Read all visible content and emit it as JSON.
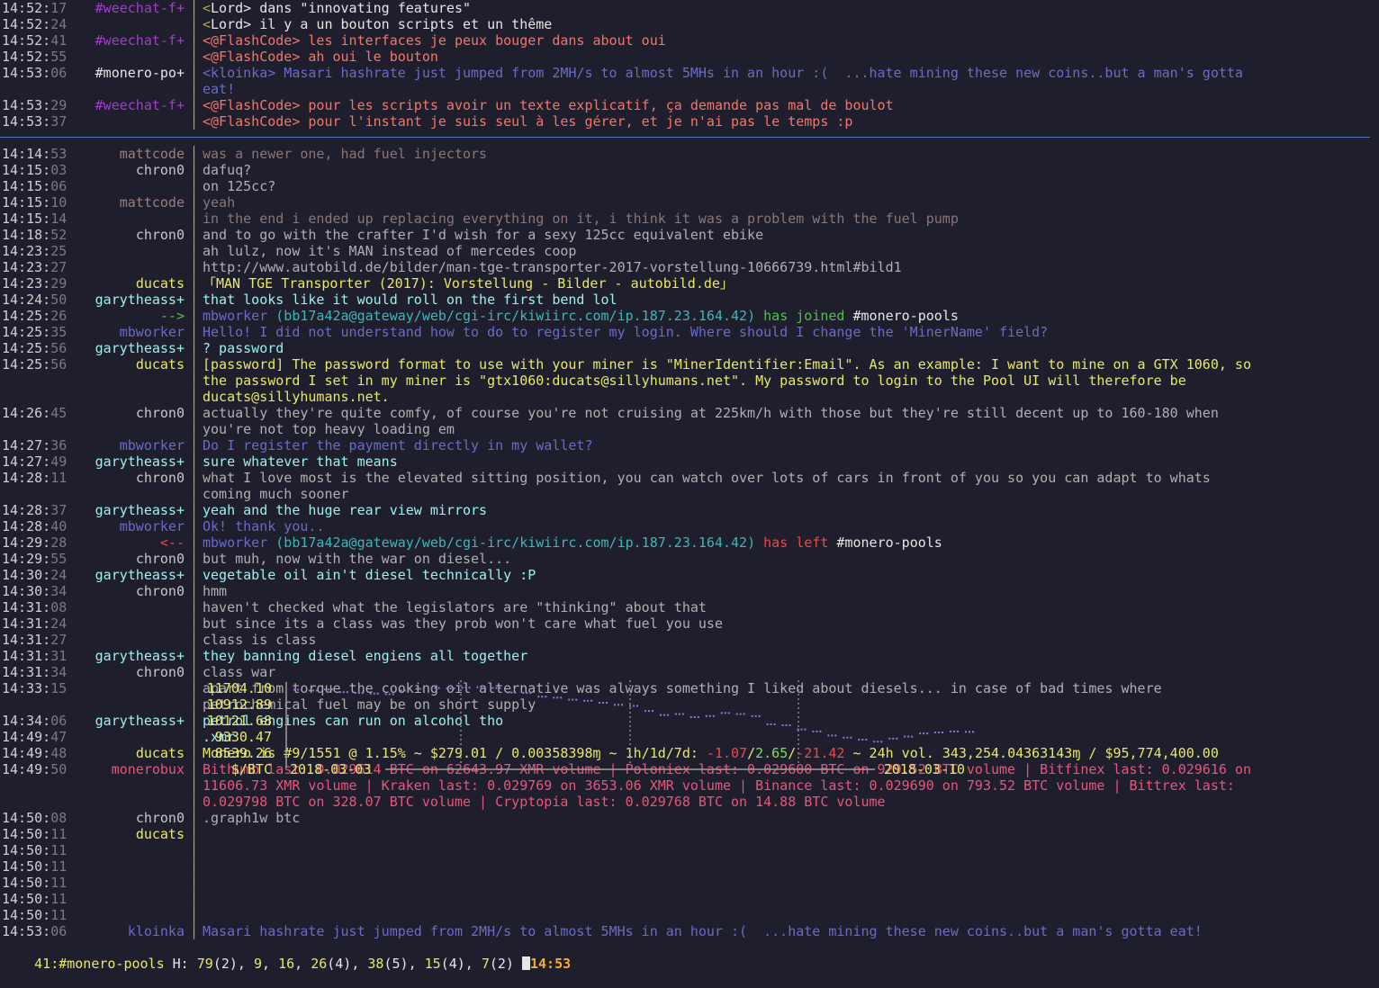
{
  "top_pane": [
    {
      "time": "14:52",
      "sec": "17",
      "nick": "#weechat-f+",
      "nick_color": "#a23fc9",
      "msg": [
        {
          "t": "<",
          "c": "#b7a63f"
        },
        {
          "t": "Lord",
          "c": "#e6e6e6"
        },
        {
          "t": "> dans \"innovating features\"",
          "c": "#e6e6e6"
        }
      ]
    },
    {
      "time": "14:52",
      "sec": "24",
      "nick": "",
      "nick_color": "#a23fc9",
      "msg": [
        {
          "t": "<",
          "c": "#b7a63f"
        },
        {
          "t": "Lord",
          "c": "#e6e6e6"
        },
        {
          "t": "> il y a un bouton scripts et un thême",
          "c": "#e6e6e6"
        }
      ]
    },
    {
      "time": "14:52",
      "sec": "41",
      "nick": "#weechat-f+",
      "nick_color": "#a23fc9",
      "msg": [
        {
          "t": "<@FlashCode> les interfaces je peux bouger dans about oui",
          "c": "#f0776c"
        }
      ]
    },
    {
      "time": "14:52",
      "sec": "55",
      "nick": "",
      "nick_color": "#a23fc9",
      "msg": [
        {
          "t": "<@FlashCode> ah oui le bouton",
          "c": "#f0776c"
        }
      ]
    },
    {
      "time": "14:53",
      "sec": "06",
      "nick": "#monero-po+",
      "nick_color": "#e6e6e6",
      "msg": [
        {
          "t": "<kloinka> Masari hashrate just jumped from 2MH/s to almost 5MHs in an hour :(  ...hate mining these new coins..but a man's gotta",
          "c": "#6b6bc7"
        }
      ]
    },
    {
      "time": "",
      "sec": "",
      "nick": "",
      "nick_color": "#e6e6e6",
      "msg": [
        {
          "t": "eat!",
          "c": "#6b6bc7"
        }
      ]
    },
    {
      "time": "14:53",
      "sec": "29",
      "nick": "#weechat-f+",
      "nick_color": "#a23fc9",
      "msg": [
        {
          "t": "<@FlashCode> pour les scripts avoir un texte explicatif, ça demande pas mal de boulot",
          "c": "#f0776c"
        }
      ]
    },
    {
      "time": "14:53",
      "sec": "37",
      "nick": "",
      "nick_color": "#a23fc9",
      "msg": [
        {
          "t": "<@FlashCode> pour l'instant je suis seul à les gérer, et je n'ai pas le temps :p",
          "c": "#f0776c"
        }
      ]
    }
  ],
  "bottom_pane": [
    {
      "time": "14:14",
      "sec": "53",
      "nick": "mattcode",
      "nick_color": "#9b7f7f",
      "msg": [
        {
          "t": "was a newer one, had fuel injectors",
          "c": "#8a7676"
        }
      ]
    },
    {
      "time": "14:15",
      "sec": "03",
      "nick": "chron0",
      "nick_color": "#c8c8c8",
      "msg": [
        {
          "t": "dafuq?",
          "c": "#b0b0b0"
        }
      ]
    },
    {
      "time": "14:15",
      "sec": "06",
      "nick": "",
      "nick_color": "#c8c8c8",
      "msg": [
        {
          "t": "on 125cc?",
          "c": "#b0b0b0"
        }
      ]
    },
    {
      "time": "14:15",
      "sec": "10",
      "nick": "mattcode",
      "nick_color": "#9b7f7f",
      "msg": [
        {
          "t": "yeah",
          "c": "#8a7676"
        }
      ]
    },
    {
      "time": "14:15",
      "sec": "14",
      "nick": "",
      "nick_color": "#9b7f7f",
      "msg": [
        {
          "t": "in the end i ended up replacing everything on it, i think it was a problem with the fuel pump",
          "c": "#8a7676"
        }
      ]
    },
    {
      "time": "14:18",
      "sec": "52",
      "nick": "chron0",
      "nick_color": "#c8c8c8",
      "msg": [
        {
          "t": "and to go with the crafter I'd wish for a sexy 125cc equivalent ebike",
          "c": "#b0b0b0"
        }
      ]
    },
    {
      "time": "14:23",
      "sec": "25",
      "nick": "",
      "nick_color": "#c8c8c8",
      "msg": [
        {
          "t": "ah lulz, now it's MAN instead of mercedes coop",
          "c": "#b0b0b0"
        }
      ]
    },
    {
      "time": "14:23",
      "sec": "27",
      "nick": "",
      "nick_color": "#c8c8c8",
      "msg": [
        {
          "t": "http://www.autobild.de/bilder/man-tge-transporter-2017-vorstellung-10666739.html#bild1",
          "c": "#b0b0b0"
        }
      ]
    },
    {
      "time": "14:23",
      "sec": "29",
      "nick": "ducats",
      "nick_color": "#e8e86a",
      "msg": [
        {
          "t": "「MAN TGE Transporter (2017): Vorstellung - Bilder - autobild.de」",
          "c": "#e8e86a"
        }
      ]
    },
    {
      "time": "14:24",
      "sec": "50",
      "nick": "garytheass+",
      "nick_color": "#9ef0ef",
      "msg": [
        {
          "t": "that looks like it would roll on the first bend lol",
          "c": "#9ef0ef"
        }
      ]
    },
    {
      "time": "14:25",
      "sec": "26",
      "nick": "-->",
      "nick_color": "#4fc04f",
      "msg": [
        {
          "t": "mbworker ",
          "c": "#6b6bc7"
        },
        {
          "t": "(bb17a42a@gateway/web/cgi-irc/kiwiirc.com/ip.187.23.164.42)",
          "c": "#3fb7b7"
        },
        {
          "t": " has joined ",
          "c": "#4fc04f"
        },
        {
          "t": "#monero-pools",
          "c": "#e6e6e6"
        }
      ]
    },
    {
      "time": "14:25",
      "sec": "35",
      "nick": "mbworker",
      "nick_color": "#6b6bc7",
      "msg": [
        {
          "t": "Hello! I did not understand how to do to register my login. Where should I change the 'MinerName' field?",
          "c": "#6b6bc7"
        }
      ]
    },
    {
      "time": "14:25",
      "sec": "56",
      "nick": "garytheass+",
      "nick_color": "#9ef0ef",
      "msg": [
        {
          "t": "? password",
          "c": "#9ef0ef"
        }
      ]
    },
    {
      "time": "14:25",
      "sec": "56",
      "nick": "ducats",
      "nick_color": "#e8e86a",
      "msg": [
        {
          "t": "[password] The password format to use with your miner is \"MinerIdentifier:Email\". As an example: I want to mine on a GTX 1060, so",
          "c": "#e8e86a"
        }
      ]
    },
    {
      "time": "",
      "sec": "",
      "nick": "",
      "nick_color": "#e8e86a",
      "msg": [
        {
          "t": "the password I set in my miner is \"gtx1060:ducats@sillyhumans.net\". My password to login to the Pool UI will therefore be",
          "c": "#e8e86a"
        }
      ]
    },
    {
      "time": "",
      "sec": "",
      "nick": "",
      "nick_color": "#e8e86a",
      "msg": [
        {
          "t": "ducats@sillyhumans.net.",
          "c": "#e8e86a"
        }
      ]
    },
    {
      "time": "14:26",
      "sec": "45",
      "nick": "chron0",
      "nick_color": "#c8c8c8",
      "msg": [
        {
          "t": "actually they're quite comfy, of course you're not cruising at 225km/h with those but they're still decent up to 160-180 when",
          "c": "#b0b0b0"
        }
      ]
    },
    {
      "time": "",
      "sec": "",
      "nick": "",
      "nick_color": "#c8c8c8",
      "msg": [
        {
          "t": "you're not top heavy loading em",
          "c": "#b0b0b0"
        }
      ]
    },
    {
      "time": "14:27",
      "sec": "36",
      "nick": "mbworker",
      "nick_color": "#6b6bc7",
      "msg": [
        {
          "t": "Do I register the payment directly in my wallet?",
          "c": "#6b6bc7"
        }
      ]
    },
    {
      "time": "14:27",
      "sec": "49",
      "nick": "garytheass+",
      "nick_color": "#9ef0ef",
      "msg": [
        {
          "t": "sure whatever that means",
          "c": "#9ef0ef"
        }
      ]
    },
    {
      "time": "14:28",
      "sec": "11",
      "nick": "chron0",
      "nick_color": "#c8c8c8",
      "msg": [
        {
          "t": "what I love most is the elevated sitting position, you can watch over lots of cars in front of you so you can adapt to whats",
          "c": "#b0b0b0"
        }
      ]
    },
    {
      "time": "",
      "sec": "",
      "nick": "",
      "nick_color": "#c8c8c8",
      "msg": [
        {
          "t": "coming much sooner",
          "c": "#b0b0b0"
        }
      ]
    },
    {
      "time": "14:28",
      "sec": "37",
      "nick": "garytheass+",
      "nick_color": "#9ef0ef",
      "msg": [
        {
          "t": "yeah and the huge rear view mirrors",
          "c": "#9ef0ef"
        }
      ]
    },
    {
      "time": "14:28",
      "sec": "40",
      "nick": "mbworker",
      "nick_color": "#6b6bc7",
      "msg": [
        {
          "t": "Ok! thank you..",
          "c": "#6b6bc7"
        }
      ]
    },
    {
      "time": "14:29",
      "sec": "28",
      "nick": "<--",
      "nick_color": "#e84a4a",
      "msg": [
        {
          "t": "mbworker ",
          "c": "#6b6bc7"
        },
        {
          "t": "(bb17a42a@gateway/web/cgi-irc/kiwiirc.com/ip.187.23.164.42)",
          "c": "#3fb7b7"
        },
        {
          "t": " has left ",
          "c": "#e84a4a"
        },
        {
          "t": "#monero-pools",
          "c": "#e6e6e6"
        }
      ]
    },
    {
      "time": "14:29",
      "sec": "55",
      "nick": "chron0",
      "nick_color": "#c8c8c8",
      "msg": [
        {
          "t": "but muh, now with the war on diesel...",
          "c": "#b0b0b0"
        }
      ]
    },
    {
      "time": "14:30",
      "sec": "24",
      "nick": "garytheass+",
      "nick_color": "#9ef0ef",
      "msg": [
        {
          "t": "vegetable oil ain't diesel technically :P",
          "c": "#9ef0ef"
        }
      ]
    },
    {
      "time": "14:30",
      "sec": "34",
      "nick": "chron0",
      "nick_color": "#c8c8c8",
      "msg": [
        {
          "t": "hmm",
          "c": "#b0b0b0"
        }
      ]
    },
    {
      "time": "14:31",
      "sec": "08",
      "nick": "",
      "nick_color": "#c8c8c8",
      "msg": [
        {
          "t": "haven't checked what the legislators are \"thinking\" about that",
          "c": "#b0b0b0"
        }
      ]
    },
    {
      "time": "14:31",
      "sec": "24",
      "nick": "",
      "nick_color": "#c8c8c8",
      "msg": [
        {
          "t": "but since its a class was they prob won't care what fuel you use",
          "c": "#b0b0b0"
        }
      ]
    },
    {
      "time": "14:31",
      "sec": "27",
      "nick": "",
      "nick_color": "#c8c8c8",
      "msg": [
        {
          "t": "class is class",
          "c": "#b0b0b0"
        }
      ]
    },
    {
      "time": "14:31",
      "sec": "31",
      "nick": "garytheass+",
      "nick_color": "#9ef0ef",
      "msg": [
        {
          "t": "they banning diesel engiens all together",
          "c": "#9ef0ef"
        }
      ]
    },
    {
      "time": "14:31",
      "sec": "34",
      "nick": "chron0",
      "nick_color": "#c8c8c8",
      "msg": [
        {
          "t": "class war",
          "c": "#b0b0b0"
        }
      ]
    },
    {
      "time": "14:33",
      "sec": "15",
      "nick": "",
      "nick_color": "#c8c8c8",
      "msg": [
        {
          "t": "apart from torque the cooking oil alternative was always something I liked about diesels... in case of bad times where",
          "c": "#b0b0b0"
        }
      ]
    },
    {
      "time": "",
      "sec": "",
      "nick": "",
      "nick_color": "#c8c8c8",
      "msg": [
        {
          "t": "petrochemical fuel may be on short supply",
          "c": "#b0b0b0"
        }
      ]
    },
    {
      "time": "14:34",
      "sec": "06",
      "nick": "garytheass+",
      "nick_color": "#9ef0ef",
      "msg": [
        {
          "t": "petrol engines can run on alcohol tho",
          "c": "#9ef0ef"
        }
      ]
    },
    {
      "time": "14:49",
      "sec": "47",
      "nick": "",
      "nick_color": "#9ef0ef",
      "msg": [
        {
          "t": ".xmr",
          "c": "#9ef0ef"
        }
      ]
    },
    {
      "time": "14:49",
      "sec": "48",
      "nick": "ducats",
      "nick_color": "#e8e86a",
      "msg": [
        {
          "t": "Monero is #9/1551 @ 1.15% ~ $279.01 / 0.00358398ɱ ~ 1h/1d/7d: ",
          "c": "#e8e86a"
        },
        {
          "t": "-1.07",
          "c": "#f04848"
        },
        {
          "t": "/",
          "c": "#e8e86a"
        },
        {
          "t": "2.65",
          "c": "#7ee05a"
        },
        {
          "t": "/",
          "c": "#e8e86a"
        },
        {
          "t": "-21.42",
          "c": "#f04848"
        },
        {
          "t": " ~ 24h vol. 343,254.04363143ɱ / $95,774,400.00",
          "c": "#e8e86a"
        }
      ]
    },
    {
      "time": "14:49",
      "sec": "50",
      "nick": "monerobux",
      "nick_color": "#e7577b",
      "msg": [
        {
          "t": "Bithumb last: 0.029614 BTC on 62643.97 XMR volume | Poloniex last: 0.029600 BTC on 929.52 BTC volume | Bitfinex last: 0.029616 on",
          "c": "#e7577b"
        }
      ]
    },
    {
      "time": "",
      "sec": "",
      "nick": "",
      "nick_color": "#e7577b",
      "msg": [
        {
          "t": "11606.73 XMR volume | Kraken last: 0.029769 on 3653.06 XMR volume | Binance last: 0.029690 on 793.52 BTC volume | Bittrex last:",
          "c": "#e7577b"
        }
      ]
    },
    {
      "time": "",
      "sec": "",
      "nick": "",
      "nick_color": "#e7577b",
      "msg": [
        {
          "t": "0.029798 BTC on 328.07 BTC volume | Cryptopia last: 0.029768 BTC on 14.88 BTC volume",
          "c": "#e7577b"
        }
      ]
    },
    {
      "time": "14:50",
      "sec": "08",
      "nick": "chron0",
      "nick_color": "#c8c8c8",
      "msg": [
        {
          "t": ".graph1w btc",
          "c": "#b0b0b0"
        }
      ]
    },
    {
      "time": "14:50",
      "sec": "11",
      "nick": "ducats",
      "nick_color": "#e8e86a",
      "msg": []
    },
    {
      "time": "14:50",
      "sec": "11",
      "nick": "",
      "nick_color": "#e8e86a",
      "msg": []
    },
    {
      "time": "14:50",
      "sec": "11",
      "nick": "",
      "nick_color": "#e8e86a",
      "msg": []
    },
    {
      "time": "14:50",
      "sec": "11",
      "nick": "",
      "nick_color": "#e8e86a",
      "msg": []
    },
    {
      "time": "14:50",
      "sec": "11",
      "nick": "",
      "nick_color": "#e8e86a",
      "msg": []
    },
    {
      "time": "14:50",
      "sec": "11",
      "nick": "",
      "nick_color": "#e8e86a",
      "msg": []
    },
    {
      "time": "14:53",
      "sec": "06",
      "nick": "kloinka",
      "nick_color": "#6b6bc7",
      "msg": [
        {
          "t": "Masari hashrate just jumped from 2MH/s to almost 5MHs in an hour :(  ...hate mining these new coins..but a man's gotta eat!",
          "c": "#6b6bc7"
        }
      ]
    }
  ],
  "chart_data": {
    "type": "line",
    "title": "",
    "ylabel": "$/BTC",
    "y_ticks": [
      "11704.10",
      "10912.89",
      "10121.68",
      "9330.47",
      "8539.26"
    ],
    "x_ticks": [
      "2018-03-03",
      "2018-03-10"
    ],
    "ylim": [
      8539.26,
      11704.1
    ],
    "series": [
      {
        "values": [
          11640,
          11600,
          11650,
          11520,
          11480,
          11450,
          11420,
          11600,
          11680,
          11720,
          11700,
          11740,
          11760,
          11720,
          11500,
          11480,
          11300,
          11250,
          11150,
          11100,
          11000,
          10900,
          10850,
          10600,
          10400,
          10450,
          10300,
          10350,
          10500,
          10450,
          10350,
          9950,
          9900,
          9700,
          9600,
          9400,
          9300,
          9200,
          9100,
          9250,
          9350,
          9500,
          9550,
          9600,
          9580
        ]
      }
    ],
    "color": "#a070d8"
  },
  "status_bar": {
    "buffer_number": "41",
    "buffer_name": ":#monero-pools",
    "hotlist_label": "H:",
    "hotlist": [
      {
        "num": "79",
        "count": "2"
      },
      {
        "num": "9",
        "count": ""
      },
      {
        "num": "16",
        "count": ""
      },
      {
        "num": "26",
        "count": "4"
      },
      {
        "num": "38",
        "count": "5"
      },
      {
        "num": "15",
        "count": "4"
      },
      {
        "num": "7",
        "count": "2"
      }
    ],
    "time": "14:53"
  }
}
